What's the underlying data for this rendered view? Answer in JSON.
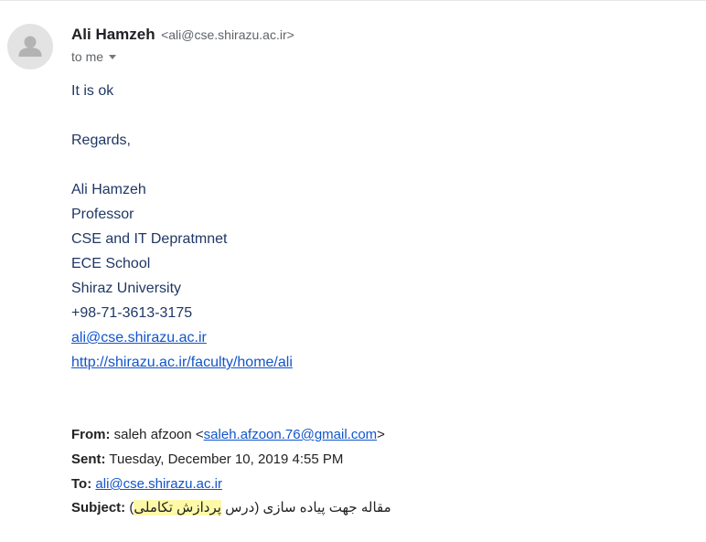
{
  "sender": {
    "name": "Ali Hamzeh",
    "email_display": "<ali@cse.shirazu.ac.ir>"
  },
  "recipient": {
    "label": "to me"
  },
  "message": {
    "greeting": "It is ok",
    "closing": "Regards,",
    "signature": {
      "name": "Ali Hamzeh",
      "title": "Professor",
      "department": "CSE and IT Depratmnet",
      "school": "ECE School",
      "university": "Shiraz University",
      "phone": "+98-71-3613-3175",
      "email": "ali@cse.shirazu.ac.ir",
      "url": "http://shirazu.ac.ir/faculty/home/ali"
    }
  },
  "quoted": {
    "from_label": "From:",
    "from_name": " saleh afzoon <",
    "from_email": "saleh.afzoon.76@gmail.com",
    "from_close": ">",
    "sent_label": "Sent:",
    "sent_value": " Tuesday, December 10, 2019 4:55 PM",
    "to_label": "To:",
    "to_email": "ali@cse.shirazu.ac.ir",
    "subject_label": "Subject:",
    "subject_part1": "مقاله جهت پیاده سازی (درس ",
    "subject_highlight": "پردازش تکاملی",
    "subject_part2": ")"
  },
  "colors": {
    "body_text": "#1f3864",
    "link": "#1155cc",
    "highlight": "#fdf9a8"
  }
}
